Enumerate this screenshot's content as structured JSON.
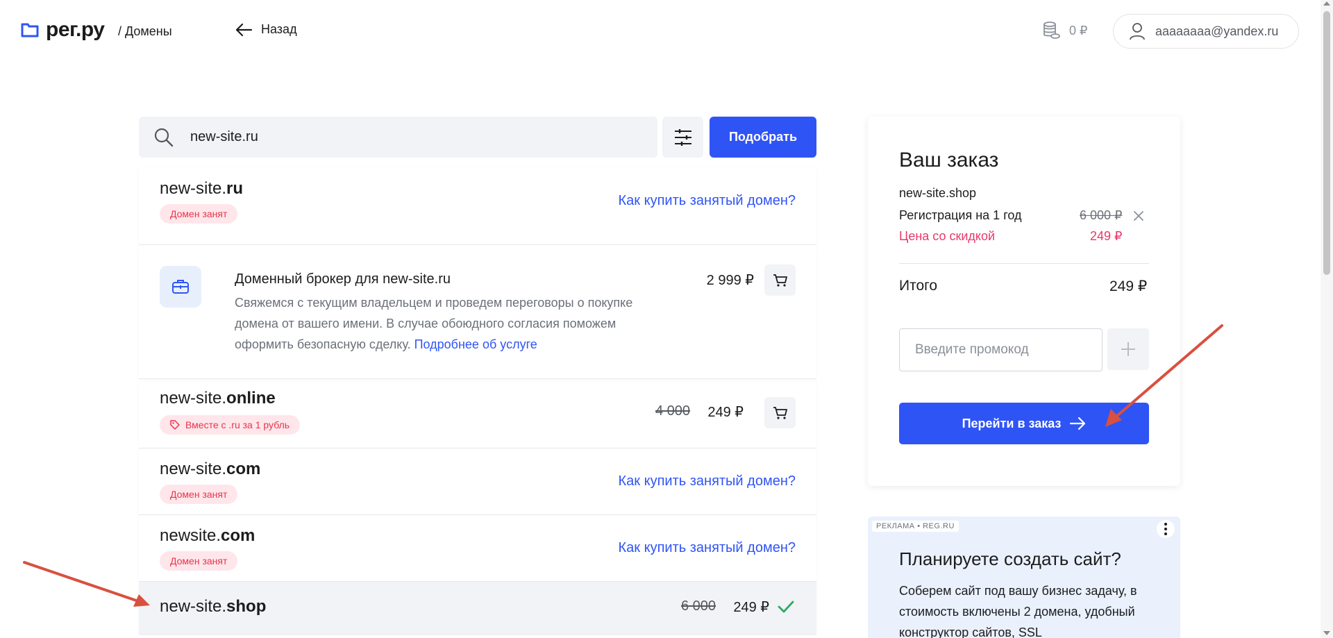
{
  "header": {
    "logo_text": "рег.ру",
    "breadcrumb": "/ Домены",
    "back_label": "Назад",
    "balance": "0 ₽",
    "account_email": "aaaaaaaa@yandex.ru"
  },
  "search": {
    "value": "new-site.ru",
    "submit_label": "Подобрать"
  },
  "results": {
    "how_to_buy_label": "Как купить занятый домен?",
    "taken_badge": "Домен занят",
    "item_ru": {
      "base": "new-site.",
      "tld": "ru"
    },
    "broker": {
      "title": "Доменный брокер для new-site.ru",
      "price": "2 999 ₽",
      "description": "Свяжемся с текущим владельцем и проведем переговоры о покупке домена от вашего имени. В случае обоюдного согласия поможем оформить безопасную сделку.",
      "more_link": "Подробнее об услуге"
    },
    "item_online": {
      "base": "new-site.",
      "tld": "online",
      "badge": "Вместе с .ru за 1 рубль",
      "old_price": "4 000",
      "price": "249 ₽"
    },
    "item_com": {
      "base": "new-site.",
      "tld": "com"
    },
    "item_newsite_com": {
      "base": "newsite.",
      "tld": "com"
    },
    "item_shop": {
      "base": "new-site.",
      "tld": "shop",
      "old_price": "6 000",
      "price": "249 ₽"
    }
  },
  "order": {
    "title": "Ваш заказ",
    "domain": "new-site.shop",
    "registration_label": "Регистрация на 1 год",
    "registration_old_price": "6 000 ₽",
    "discount_label": "Цена со скидкой",
    "discount_price": "249 ₽",
    "total_label": "Итого",
    "total_value": "249 ₽",
    "promo_placeholder": "Введите промокод",
    "checkout_label": "Перейти в заказ"
  },
  "ad": {
    "tag": "РЕКЛАМА • REG.RU",
    "title": "Планируете создать сайт?",
    "text": "Соберем сайт под вашу бизнес задачу, в стоимость включены 2 домена, удобный конструктор сайтов, SSL"
  },
  "colors": {
    "accent": "#2f54f5",
    "danger": "#e5354d",
    "discount": "#e8386a",
    "success": "#27ae60",
    "annotation": "#d9503f"
  }
}
